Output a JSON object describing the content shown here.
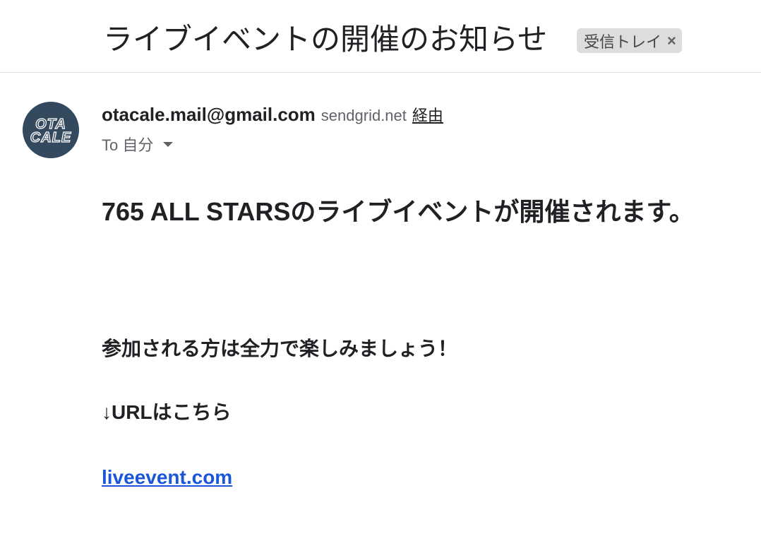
{
  "email": {
    "subject": "ライブイベントの開催のお知らせ",
    "label_chip": {
      "text": "受信トレイ",
      "close_glyph": "×"
    },
    "sender": {
      "email": "otacale.mail@gmail.com",
      "via_domain": "sendgrid.net",
      "via_label": "経由",
      "avatar": {
        "line1": "OTA",
        "line2": "CALE",
        "background": "#34495e"
      }
    },
    "recipient": {
      "text": "To 自分",
      "dropdown_icon": "caret-down-icon"
    },
    "body": {
      "heading": "765 ALL STARSのライブイベントが開催されます。",
      "line1": "参加される方は全力で楽しみましょう！",
      "line2": "↓URLはこちら",
      "link_text": "liveevent.com"
    }
  },
  "colors": {
    "link": "#1a56db",
    "chip_bg": "#dddddd",
    "divider": "#e3e3e3"
  }
}
